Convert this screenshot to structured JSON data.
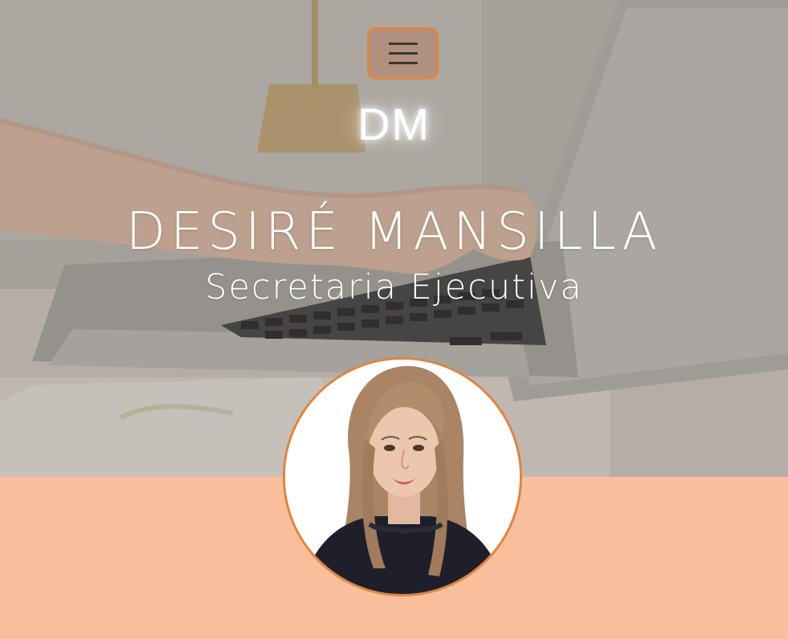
{
  "header": {
    "menu_toggle_icon": "hamburger-menu-icon",
    "logo_text": "DM"
  },
  "hero": {
    "name": "DESIRÉ MANSILLA",
    "role": "Secretaria Ejecutiva",
    "background": "laptop-typing-photo"
  },
  "profile": {
    "avatar": "profile-photo"
  },
  "colors": {
    "accent": "#e0843f",
    "section_bg": "#f9bf9c",
    "text": "#ffffff"
  }
}
